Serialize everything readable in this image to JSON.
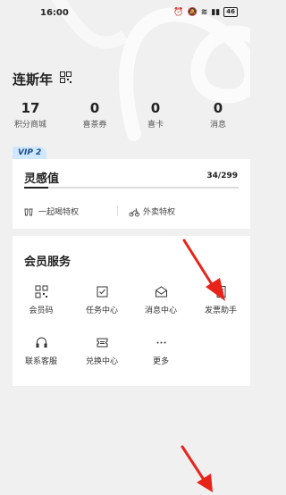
{
  "status_bar": {
    "time": "16:00",
    "battery": "46"
  },
  "user": {
    "name": "连斯年"
  },
  "stats": [
    {
      "value": "17",
      "label": "积分商城"
    },
    {
      "value": "0",
      "label": "喜茶券"
    },
    {
      "value": "0",
      "label": "喜卡"
    },
    {
      "value": "0",
      "label": "消息"
    }
  ],
  "vip": {
    "badge": "VIP 2",
    "title": "灵感值",
    "progress_text": "34/299",
    "progress_fraction": 0.114,
    "perks": [
      "一起喝特权",
      "外卖特权"
    ]
  },
  "services": {
    "title": "会员服务",
    "items": [
      {
        "label": "会员码",
        "icon": "qr-code-icon"
      },
      {
        "label": "任务中心",
        "icon": "task-list-icon"
      },
      {
        "label": "消息中心",
        "icon": "envelope-icon"
      },
      {
        "label": "发票助手",
        "icon": "invoice-icon"
      },
      {
        "label": "联系客服",
        "icon": "headset-icon"
      },
      {
        "label": "兑换中心",
        "icon": "ticket-icon"
      },
      {
        "label": "更多",
        "icon": "more-dots-icon"
      }
    ]
  },
  "colors": {
    "page_bg": "#f0f0f0",
    "card_bg": "#ffffff",
    "vip_badge_bg": "#cfe8ff",
    "arrow": "#e8231a"
  }
}
